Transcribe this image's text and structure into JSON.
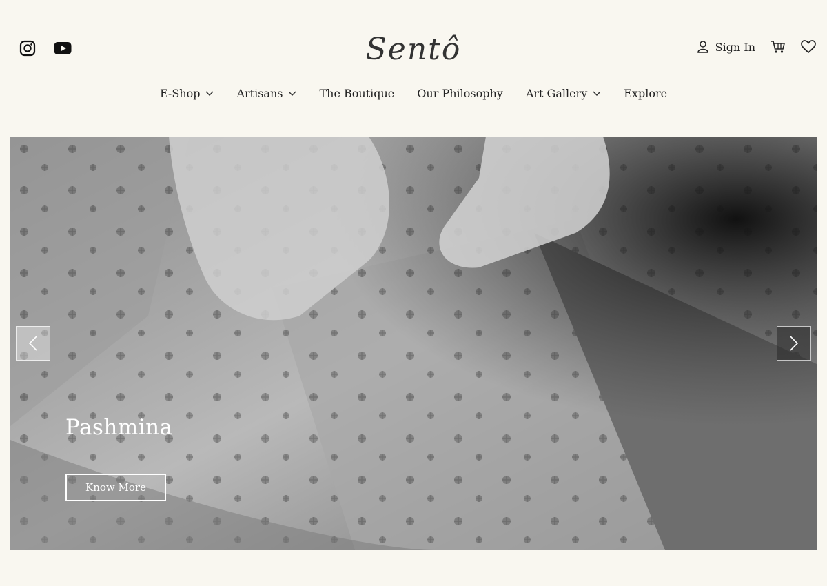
{
  "header": {
    "logo_text": "Sentô",
    "social": [
      {
        "icon": "instagram-icon"
      },
      {
        "icon": "youtube-icon"
      }
    ],
    "account": {
      "signin_label": "Sign In",
      "icons": [
        "user-icon",
        "cart-icon",
        "heart-icon"
      ]
    }
  },
  "nav": {
    "items": [
      {
        "label": "E-Shop",
        "has_dropdown": true
      },
      {
        "label": "Artisans",
        "has_dropdown": true
      },
      {
        "label": "The Boutique",
        "has_dropdown": false
      },
      {
        "label": "Our Philosophy",
        "has_dropdown": false
      },
      {
        "label": "Art Gallery",
        "has_dropdown": true
      },
      {
        "label": "Explore",
        "has_dropdown": false
      }
    ]
  },
  "hero": {
    "slide_title": "Pashmina",
    "cta_label": "Know More",
    "icons": [
      "chevron-left-icon",
      "chevron-right-icon"
    ]
  },
  "colors": {
    "background": "#f9f7f0",
    "text": "#222222"
  }
}
